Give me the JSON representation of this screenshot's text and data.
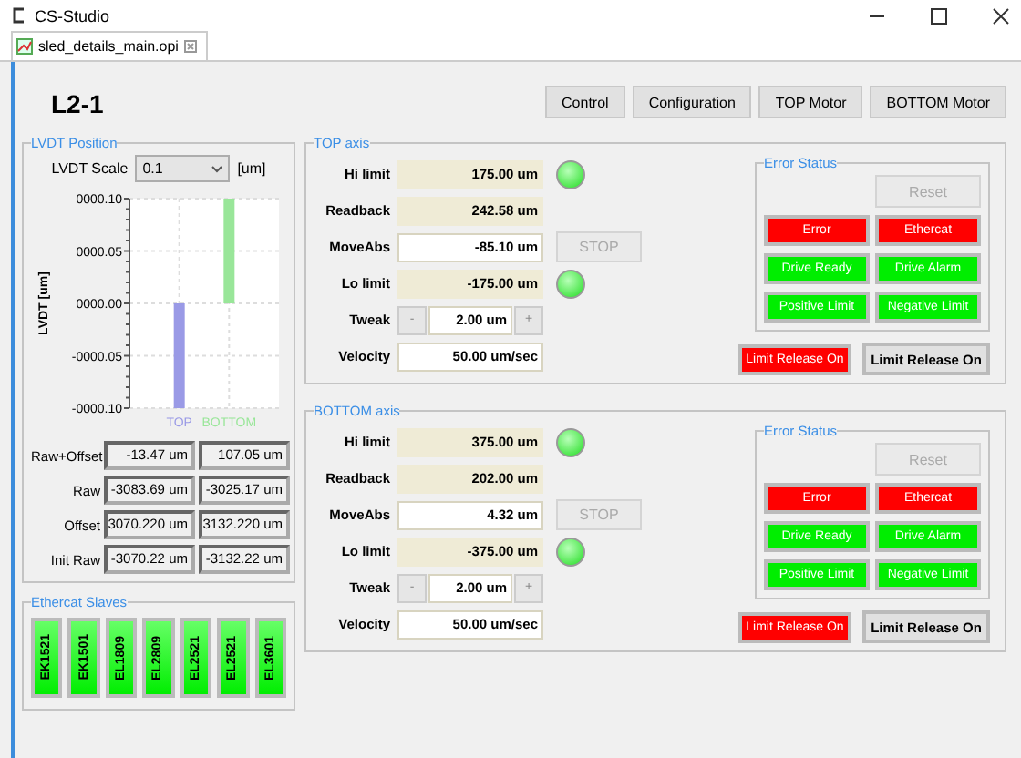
{
  "window": {
    "title": "CS-Studio"
  },
  "tab": {
    "label": "sled_details_main.opi",
    "selected": true
  },
  "header": {
    "title": "L2-1",
    "buttons": [
      "Control",
      "Configuration",
      "TOP Motor",
      "BOTTOM Motor"
    ]
  },
  "lvdt": {
    "title": "LVDT Position",
    "scale_label": "LVDT Scale",
    "scale_value": "0.1",
    "scale_unit": "[um]",
    "chart_data": {
      "type": "bar",
      "ylabel": "LVDT [um]",
      "categories": [
        "TOP",
        "BOTTOM"
      ],
      "grid": true,
      "series": [
        {
          "color": "#9a9ae6",
          "values": [
            -0.1,
            null
          ]
        },
        {
          "color": "#99e699",
          "values": [
            null,
            0.1
          ]
        }
      ],
      "ylim": [
        -0.1,
        0.1
      ],
      "yticks": [
        {
          "value": 0.1,
          "label": "0000.10"
        },
        {
          "value": 0.05,
          "label": "0000.05"
        },
        {
          "value": 0,
          "label": "0000.00"
        },
        {
          "value": -0.05,
          "label": "-0000.05"
        },
        {
          "value": -0.1,
          "label": "-0000.10"
        }
      ]
    },
    "readings": [
      {
        "label": "Raw+Offset",
        "values": [
          "-13.47 um",
          "107.05 um"
        ]
      },
      {
        "label": "Raw",
        "values": [
          "-3083.69 um",
          "-3025.17 um"
        ]
      },
      {
        "label": "Offset",
        "values": [
          "3070.220 um",
          "3132.220 um"
        ]
      },
      {
        "label": "Init Raw",
        "values": [
          "-3070.22 um",
          "-3132.22 um"
        ]
      }
    ]
  },
  "ethercat": {
    "title": "Ethercat Slaves",
    "slaves": [
      "EK1521",
      "EK1501",
      "EL1809",
      "EL2809",
      "EL2521",
      "EL2521",
      "EL3601"
    ]
  },
  "axes": [
    {
      "title": "TOP axis",
      "rows": [
        {
          "kind": "readback",
          "label": "Hi limit",
          "value": "175.00 um",
          "led": {
            "on": true
          }
        },
        {
          "kind": "readback",
          "label": "Readback",
          "value": "242.58 um"
        },
        {
          "kind": "input",
          "label": "MoveAbs",
          "value": "-85.10 um",
          "stop": {
            "label": "STOP",
            "disabled": true
          }
        },
        {
          "kind": "readback",
          "label": "Lo limit",
          "value": "-175.00 um",
          "led": {
            "on": true
          }
        },
        {
          "kind": "tweak",
          "label": "Tweak",
          "value": "2.00 um",
          "minus": "-",
          "plus": "+"
        },
        {
          "kind": "input",
          "label": "Velocity",
          "value": "50.00 um/sec"
        }
      ],
      "error_status": {
        "title": "Error Status",
        "reset": {
          "label": "Reset",
          "disabled": true
        },
        "flags": [
          {
            "label": "Error",
            "color": "#ff0000"
          },
          {
            "label": "Ethercat",
            "color": "#ff0000"
          },
          {
            "label": "Drive Ready",
            "color": "#00ee00"
          },
          {
            "label": "Drive Alarm",
            "color": "#00ee00"
          },
          {
            "label": "Positive Limit",
            "color": "#00ee00"
          },
          {
            "label": "Negative Limit",
            "color": "#00ee00"
          }
        ]
      },
      "limit_indicator": {
        "label": "Limit Release On",
        "color": "#ff0000"
      },
      "limit_button": "Limit Release On"
    },
    {
      "title": "BOTTOM axis",
      "rows": [
        {
          "kind": "readback",
          "label": "Hi limit",
          "value": "375.00 um",
          "led": {
            "on": true
          }
        },
        {
          "kind": "readback",
          "label": "Readback",
          "value": "202.00 um"
        },
        {
          "kind": "input",
          "label": "MoveAbs",
          "value": "4.32 um",
          "stop": {
            "label": "STOP",
            "disabled": true
          }
        },
        {
          "kind": "readback",
          "label": "Lo limit",
          "value": "-375.00 um",
          "led": {
            "on": true
          }
        },
        {
          "kind": "tweak",
          "label": "Tweak",
          "value": "2.00 um",
          "minus": "-",
          "plus": "+"
        },
        {
          "kind": "input",
          "label": "Velocity",
          "value": "50.00 um/sec"
        }
      ],
      "error_status": {
        "title": "Error Status",
        "reset": {
          "label": "Reset",
          "disabled": true
        },
        "flags": [
          {
            "label": "Error",
            "color": "#ff0000"
          },
          {
            "label": "Ethercat",
            "color": "#ff0000"
          },
          {
            "label": "Drive Ready",
            "color": "#00ee00"
          },
          {
            "label": "Drive Alarm",
            "color": "#00ee00"
          },
          {
            "label": "Positive Limit",
            "color": "#00ee00"
          },
          {
            "label": "Negative Limit",
            "color": "#00ee00"
          }
        ]
      },
      "limit_indicator": {
        "label": "Limit Release On",
        "color": "#ff0000"
      },
      "limit_button": "Limit Release On"
    }
  ]
}
